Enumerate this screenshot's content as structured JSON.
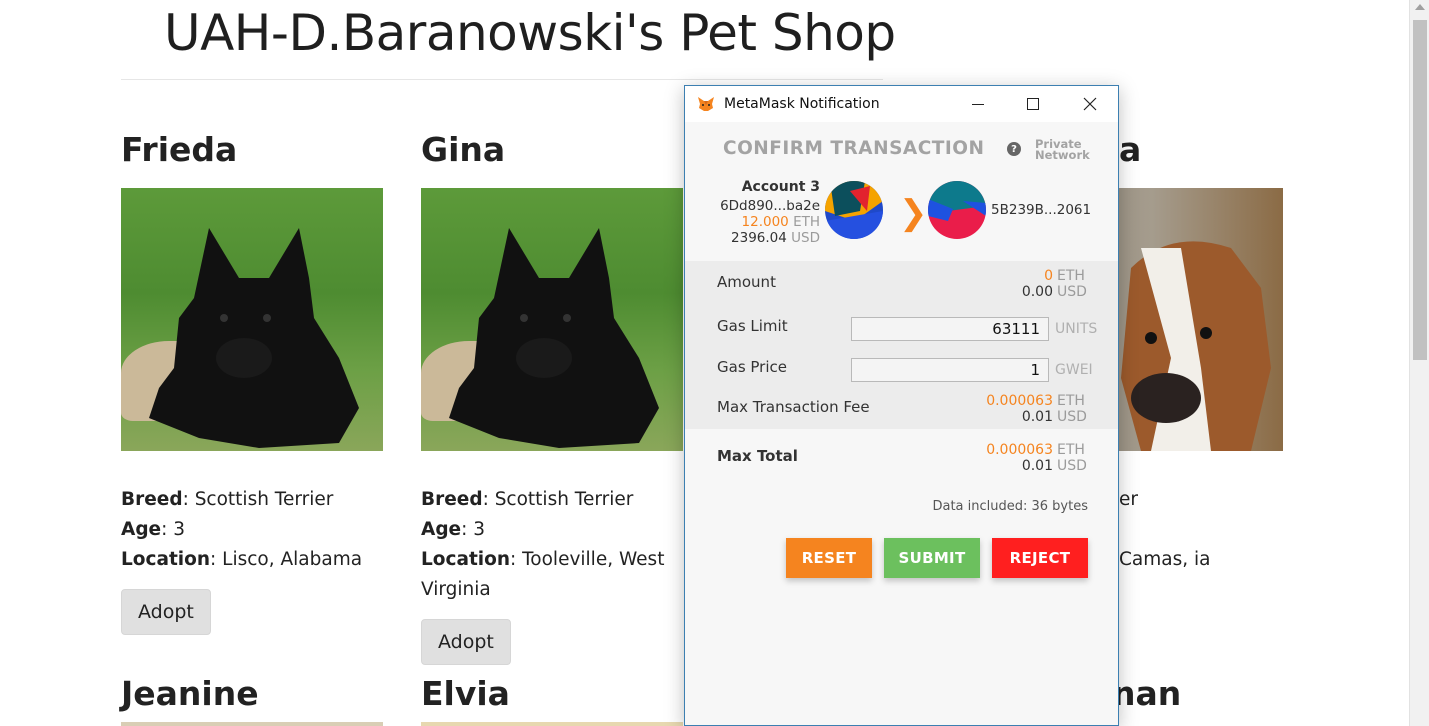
{
  "page": {
    "title": "UAH-D.Baranowski's Pet Shop",
    "labels": {
      "breed": "Breed",
      "age": "Age",
      "location": "Location"
    },
    "adopt_label": "Adopt",
    "pets_row1": [
      {
        "name": "Frieda",
        "breed": "Scottish Terrier",
        "age": "3",
        "location": "Lisco, Alabama"
      },
      {
        "name": "Gina",
        "breed": "Scottish Terrier",
        "age": "3",
        "location": "Tooleville, West Virginia"
      },
      {
        "name": "a",
        "breed": "er",
        "age": "",
        "location": "Camas, ia"
      }
    ],
    "pets_row2": [
      {
        "name": "Jeanine"
      },
      {
        "name": "Elvia"
      },
      {
        "name": "nan"
      }
    ]
  },
  "metamask": {
    "window_title": "MetaMask Notification",
    "header": "CONFIRM TRANSACTION",
    "network_line1": "Private",
    "network_line2": "Network",
    "from": {
      "account": "Account 3",
      "address": "6Dd890...ba2e",
      "balance_eth": "12.000",
      "balance_usd": "2396.04",
      "eth_unit": "ETH",
      "usd_unit": "USD"
    },
    "to": {
      "address": "5B239B...2061"
    },
    "amount": {
      "label": "Amount",
      "eth": "0",
      "usd": "0.00"
    },
    "gas_limit": {
      "label": "Gas Limit",
      "value": "63111",
      "unit": "UNITS"
    },
    "gas_price": {
      "label": "Gas Price",
      "value": "1",
      "unit": "GWEI"
    },
    "max_fee": {
      "label": "Max Transaction Fee",
      "eth": "0.000063",
      "usd": "0.01"
    },
    "max_total": {
      "label": "Max Total",
      "eth": "0.000063",
      "usd": "0.01"
    },
    "data_included": "Data included: 36 bytes",
    "buttons": {
      "reset": "RESET",
      "submit": "SUBMIT",
      "reject": "REJECT"
    },
    "colors": {
      "accent": "#f5841f",
      "submit": "#6cc05e",
      "reject": "#ff1f1f"
    }
  }
}
